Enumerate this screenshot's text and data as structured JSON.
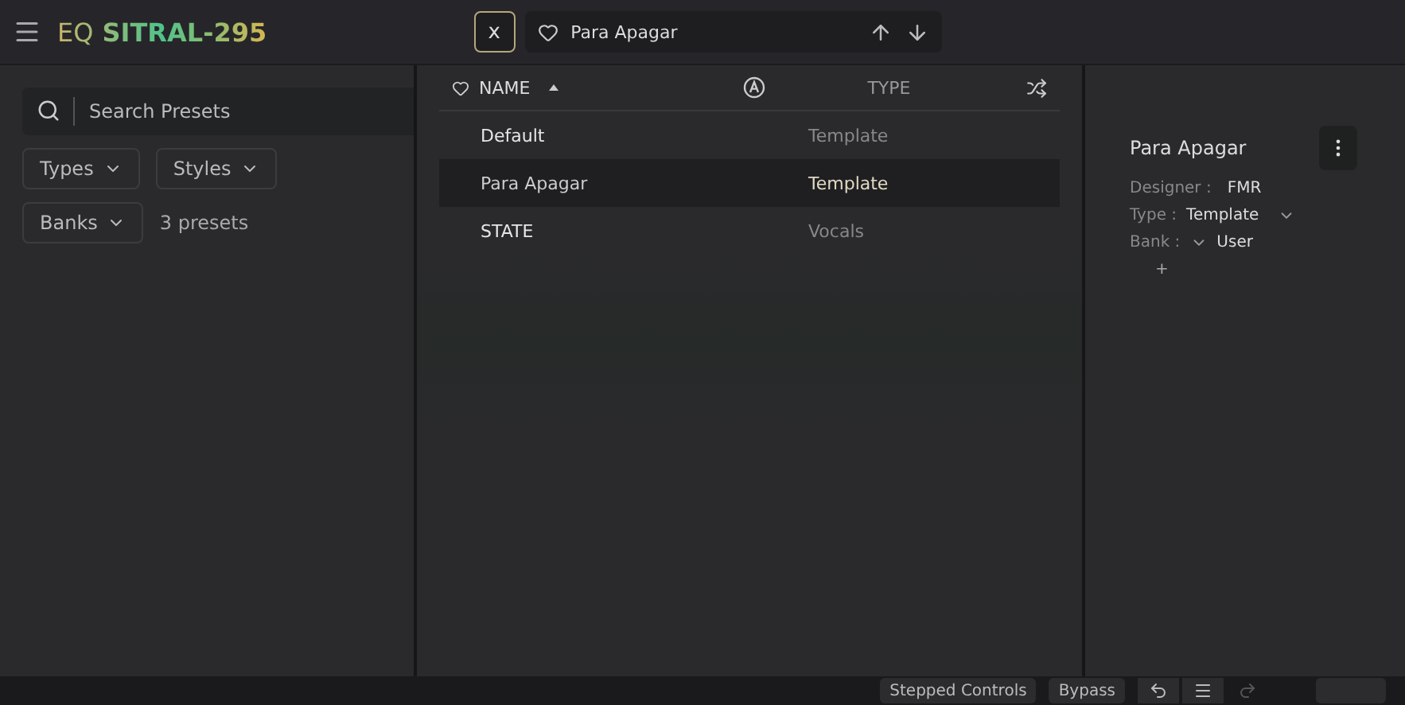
{
  "header": {
    "logo_prefix": "EQ",
    "logo_name": "SITRAL-295",
    "close_label": "x",
    "current_preset": "Para Apagar"
  },
  "sidebar": {
    "search": {
      "placeholder": "Search Presets"
    },
    "filters": [
      "Types",
      "Styles",
      "Banks"
    ],
    "count": "3 presets"
  },
  "table": {
    "columns": [
      "NAME",
      "TYPE"
    ],
    "rows": [
      {
        "name": "Default",
        "type": "Template",
        "selected": false
      },
      {
        "name": "Para Apagar",
        "type": "Template",
        "selected": true
      },
      {
        "name": "STATE",
        "type": "Vocals",
        "selected": false
      }
    ]
  },
  "details": {
    "title": "Para Apagar",
    "designer_label": "Designer :",
    "designer": "FMR",
    "type_label": "Type :",
    "type": "Template",
    "bank_label": "Bank :",
    "bank": "User",
    "add": "+"
  },
  "status_bar": {
    "buttons": [
      "Stepped Controls",
      "Bypass"
    ],
    "redo_disabled": true
  }
}
